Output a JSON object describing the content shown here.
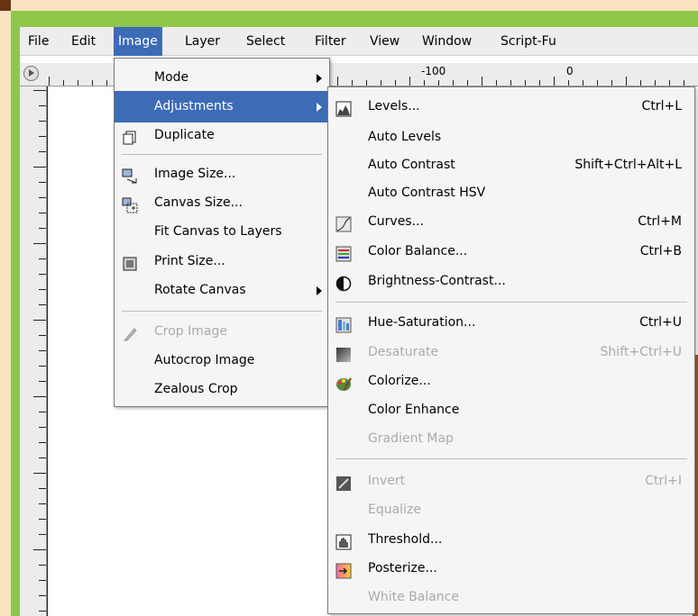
{
  "menubar": {
    "items": [
      "File",
      "Edit",
      "Image",
      "Layer",
      "Select",
      "Filter",
      "View",
      "Window",
      "Script-Fu"
    ]
  },
  "ruler": {
    "label_a": "-100",
    "label_b": "0"
  },
  "image_menu": {
    "items": [
      {
        "label": "Mode",
        "submenu": true
      },
      {
        "label": "Adjustments",
        "submenu": true,
        "highlighted": true
      },
      {
        "label": "Duplicate",
        "icon": "duplicate-icon"
      },
      {
        "label": "Image Size...",
        "icon": "image-size-icon"
      },
      {
        "label": "Canvas Size...",
        "icon": "canvas-size-icon"
      },
      {
        "label": "Fit Canvas to Layers"
      },
      {
        "label": "Print Size...",
        "icon": "print-size-icon"
      },
      {
        "label": "Rotate Canvas",
        "submenu": true
      },
      {
        "label": "Crop Image",
        "icon": "crop-icon",
        "disabled": true
      },
      {
        "label": "Autocrop Image"
      },
      {
        "label": "Zealous Crop"
      }
    ]
  },
  "adjustments_menu": {
    "items": [
      {
        "label": "Levels...",
        "shortcut": "Ctrl+L",
        "icon": "levels-icon"
      },
      {
        "label": "Auto Levels"
      },
      {
        "label": "Auto Contrast",
        "shortcut": "Shift+Ctrl+Alt+L"
      },
      {
        "label": "Auto Contrast HSV"
      },
      {
        "label": "Curves...",
        "shortcut": "Ctrl+M",
        "icon": "curves-icon"
      },
      {
        "label": "Color Balance...",
        "shortcut": "Ctrl+B",
        "icon": "color-balance-icon"
      },
      {
        "label": "Brightness-Contrast...",
        "icon": "brightness-contrast-icon"
      },
      {
        "label": "Hue-Saturation...",
        "shortcut": "Ctrl+U",
        "icon": "hue-saturation-icon"
      },
      {
        "label": "Desaturate",
        "shortcut": "Shift+Ctrl+U",
        "icon": "desaturate-icon",
        "disabled": true
      },
      {
        "label": "Colorize...",
        "icon": "colorize-icon"
      },
      {
        "label": "Color Enhance"
      },
      {
        "label": "Gradient Map",
        "disabled": true
      },
      {
        "label": "Invert",
        "shortcut": "Ctrl+I",
        "icon": "invert-icon",
        "disabled": true
      },
      {
        "label": "Equalize",
        "disabled": true
      },
      {
        "label": "Threshold...",
        "icon": "threshold-icon"
      },
      {
        "label": "Posterize...",
        "icon": "posterize-icon"
      },
      {
        "label": "White Balance",
        "disabled": true
      }
    ]
  },
  "colors": {
    "highlight": "#3d6bb6",
    "green_frame": "#8fc74a",
    "background": "#fbe3c2",
    "disabled_text": "#aaaaaa"
  }
}
